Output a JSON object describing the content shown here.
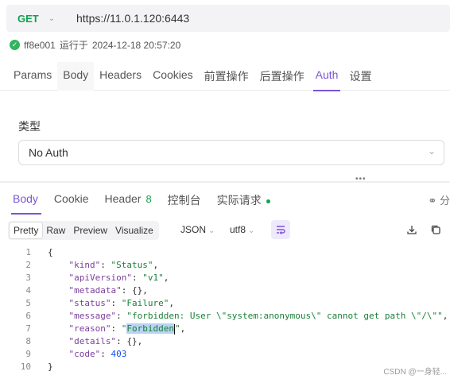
{
  "request": {
    "method": "GET",
    "url": "https://11.0.1.120:6443"
  },
  "run_info": {
    "id": "ff8e001",
    "label": "运行于",
    "timestamp": "2024-12-18 20:57:20"
  },
  "request_tabs": [
    {
      "label": "Params"
    },
    {
      "label": "Body"
    },
    {
      "label": "Headers"
    },
    {
      "label": "Cookies"
    },
    {
      "label": "前置操作"
    },
    {
      "label": "后置操作"
    },
    {
      "label": "Auth"
    },
    {
      "label": "设置"
    }
  ],
  "auth": {
    "type_label": "类型",
    "selected": "No Auth"
  },
  "response_tabs": [
    {
      "label": "Body"
    },
    {
      "label": "Cookie"
    },
    {
      "label": "Header",
      "count": "8"
    },
    {
      "label": "控制台"
    },
    {
      "label": "实际请求"
    }
  ],
  "share_label": "分",
  "view_modes": [
    "Pretty",
    "Raw",
    "Preview",
    "Visualize"
  ],
  "format": "JSON",
  "encoding": "utf8",
  "code_lines": [
    {
      "n": "1",
      "t": "{"
    },
    {
      "n": "2",
      "t": "    \"kind\": \"Status\","
    },
    {
      "n": "3",
      "t": "    \"apiVersion\": \"v1\","
    },
    {
      "n": "4",
      "t": "    \"metadata\": {},"
    },
    {
      "n": "5",
      "t": "    \"status\": \"Failure\","
    },
    {
      "n": "6",
      "t": "    \"message\": \"forbidden: User \\\"system:anonymous\\\" cannot get path \\\"/\\\"\","
    },
    {
      "n": "7",
      "t": "    \"reason\": \"Forbidden\","
    },
    {
      "n": "8",
      "t": "    \"details\": {},"
    },
    {
      "n": "9",
      "t": "    \"code\": 403"
    },
    {
      "n": "10",
      "t": "}"
    }
  ],
  "watermark": "CSDN @一身轻...",
  "colors": {
    "accent": "#7b55d7",
    "method_get": "#12a150",
    "success": "#2fb55f"
  }
}
